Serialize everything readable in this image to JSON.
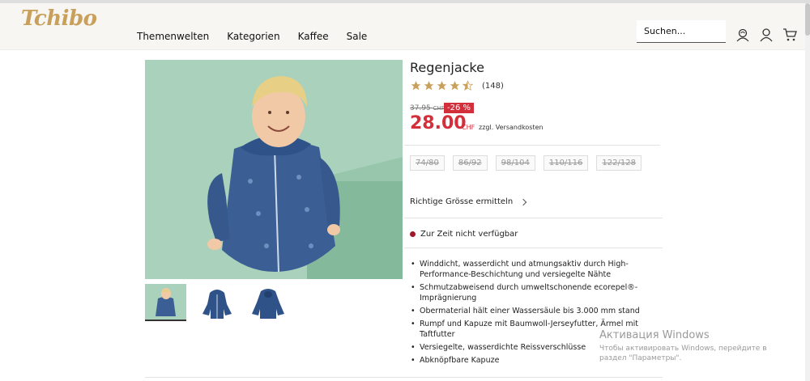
{
  "brand": {
    "logo_text": "Tchibo",
    "color": "#c8a05c"
  },
  "nav": {
    "items": [
      "Themenwelten",
      "Kategorien",
      "Kaffee",
      "Sale"
    ]
  },
  "search": {
    "placeholder": "Suchen..."
  },
  "header_icons": [
    "account-coffee-icon",
    "user-icon",
    "cart-icon"
  ],
  "product": {
    "title": "Regenjacke",
    "rating": 4.5,
    "rating_max": 5,
    "review_count": "(148)",
    "old_price": "37.95",
    "old_currency": "CHF",
    "discount": "-26 %",
    "price": "28.00",
    "currency": "CHF",
    "shipping": "zzgl. Versandkosten",
    "sizes": [
      "74/80",
      "86/92",
      "98/104",
      "110/116",
      "122/128"
    ],
    "size_guide": "Richtige Grösse ermitteln",
    "availability": "Zur Zeit nicht verfügbar",
    "features": [
      "Winddicht, wasserdicht und atmungsaktiv durch High-Performance-Beschichtung und versiegelte Nähte",
      "Schmutzabweisend durch umweltschonende ecorepel®-Imprägnierung",
      "Obermaterial hält einer Wassersäule bis 3.000 mm stand",
      "Rumpf und Kapuze mit Baumwoll-Jerseyfutter, Ärmel mit Taftfutter",
      "Versiegelte, wasserdichte Reissverschlüsse",
      "Abknöpfbare Kapuze"
    ]
  },
  "colors": {
    "price_red": "#d32f3b",
    "star_gold": "#c8a05c",
    "status_dot": "#a0182b"
  },
  "watermark": {
    "title": "Активация Windows",
    "subtitle": "Чтобы активировать Windows, перейдите в раздел \"Параметры\"."
  }
}
